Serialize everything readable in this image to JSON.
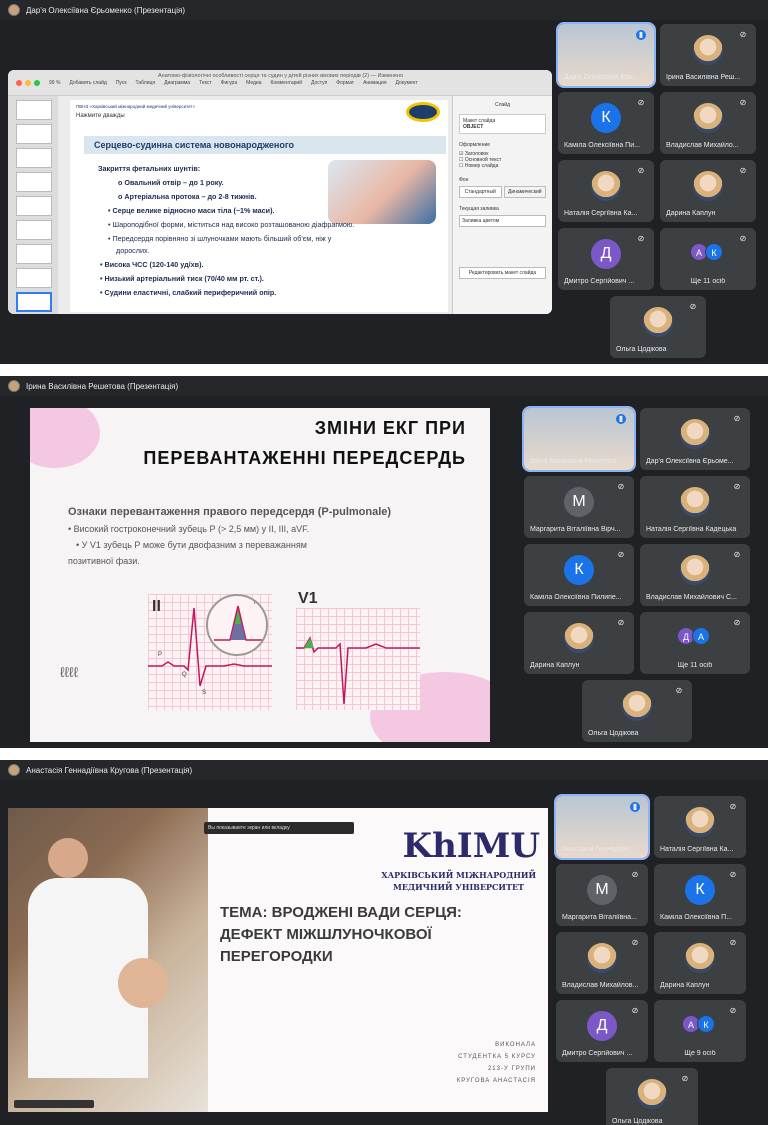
{
  "panel1": {
    "title": "Дар'я Олексіївна Єрьоменко (Презентація)",
    "keynote": {
      "window_title": "Анатомо-фізіологічні особливості серця та судин у дітей різних вікових періодів (2) — Изменено",
      "zoom": "99 %",
      "toolbar": [
        "Вид",
        "Масштаб",
        "Добавить слайд",
        "Пуск",
        "Таблиця",
        "Диаграмма",
        "Текст",
        "Фигура",
        "Медиа",
        "Комментарий",
        "Доступ",
        "Формат",
        "Анимация",
        "Документ"
      ],
      "inspector": {
        "tab": "Слайд",
        "layout_label": "Макет слайда",
        "layout_value": "OBJECT",
        "appearance": "Оформление",
        "opt1": "Заголовок",
        "opt2": "Основной текст",
        "opt3": "Номер слайда",
        "bg": "Фон",
        "bg1": "Стандартный",
        "bg2": "Динамический",
        "fill_label": "Текущая заливка",
        "fill_value": "Заливка цветом",
        "edit_btn": "Редактировать макет слайда"
      },
      "slide": {
        "org": "ПВНЗ «Харківський міжнародний медичний університет»",
        "click_hint": "Нажмите дважды",
        "heading": "Серцево-судинна система новонародженого",
        "lines": [
          "Закриття фетальних шунтів:",
          "Овальний отвір – до 1 року.",
          "Артеріальна протока – до 2-8 тижнів.",
          "Серце велике відносно маси тіла (~1% маси).",
          "Шароподібної форми, міститься над високо розташованою діафрагмою.",
          "Передсердя порівняно зі шлуночками мають більший об'єм, ніж у",
          "дорослих.",
          "Висока ЧСС (120-140 уд/хв).",
          "Низький артеріальний тиск (70/40 мм рт. ст.).",
          "Судини еластичні, слабкий периферичний опір."
        ]
      }
    },
    "participants": [
      {
        "name": "Дар'я Олексіївна Єрь...",
        "active": true
      },
      {
        "name": "Ірина Василівна Реш..."
      },
      {
        "name": "Каміла Олексіївна Пи...",
        "letter": "К",
        "color": "#1a73e8"
      },
      {
        "name": "Владислав Михайло..."
      },
      {
        "name": "Наталія Сергіївна Ка..."
      },
      {
        "name": "Дарина Каплун"
      },
      {
        "name": "Дмитро Сергійович ...",
        "letter": "Д",
        "color": "#7b57c8"
      },
      {
        "name": "Ще 11 осіб",
        "pair": [
          "А",
          "К"
        ]
      },
      {
        "name": "Ольга Цодікова"
      }
    ]
  },
  "panel2": {
    "title": "Ірина Василівна Решетова (Презентація)",
    "slide": {
      "title_line1": "ЗМІНИ ЕКГ ПРИ",
      "title_line2": "ПЕРЕВАНТАЖЕННІ ПЕРЕДСЕРДЬ",
      "subtitle": "Ознаки перевантаження правого передсердя (P-pulmonale)",
      "bullet1": "• Високий гостроконечний зубець Р (> 2,5 мм) у II, III, aVF.",
      "bullet2": "• У V1 зубець Р може бути двофазним з переважанням",
      "bullet2b": "позитивної фази.",
      "lead_ii": "II",
      "lead_v1": "V1",
      "label_p": "P",
      "label_q": "Q",
      "label_s": "S",
      "label_r": "R",
      "scribble": "ℓℓℓℓ"
    },
    "participants": [
      {
        "name": "Ірина Василівна Решетова",
        "active": true
      },
      {
        "name": "Дар'я Олексіївна Єрьоме..."
      },
      {
        "name": "Маргарита Віталіївна Вірч...",
        "letter": "М",
        "color": "#5f6368"
      },
      {
        "name": "Наталія Сергіївна Кадецька"
      },
      {
        "name": "Каміла Олексіївна Пилипе...",
        "letter": "К",
        "color": "#1a73e8"
      },
      {
        "name": "Владислав Михайлович С..."
      },
      {
        "name": "Дарина Каплун"
      },
      {
        "name": "Ще 11 осіб",
        "pair": [
          "Д",
          "А"
        ]
      },
      {
        "name": "Ольга Цодікова"
      }
    ]
  },
  "panel3": {
    "title": "Анастасія Геннадіївна Кругова (Презентація)",
    "screen_share_bar": "Вы показываете экран или вкладку",
    "slide": {
      "logo": "KhIMU",
      "uni1": "ХАРКІВСЬКИЙ МІЖНАРОДНИЙ",
      "uni2": "МЕДИЧНИЙ УНІВЕРСИТЕТ",
      "topic1": "ТЕМА: ВРОДЖЕНІ ВАДИ СЕРЦЯ:",
      "topic2": "ДЕФЕКТ МІЖШЛУНОЧКОВОЇ",
      "topic3": "ПЕРЕГОРОДКИ",
      "sig1": "ВИКОНАЛА",
      "sig2": "СТУДЕНТКА 5 КУРСУ",
      "sig3": "213-У ГРУПИ",
      "sig4": "КРУГОВА АНАСТАСІЯ"
    },
    "participants": [
      {
        "name": "Анастасія Геннадіївн...",
        "active": true
      },
      {
        "name": "Наталія Сергіївна Ка..."
      },
      {
        "name": "Маргарита Віталіївна...",
        "letter": "М",
        "color": "#5f6368"
      },
      {
        "name": "Каміла Олексіївна П...",
        "letter": "К",
        "color": "#1a73e8"
      },
      {
        "name": "Владислав Михайлов..."
      },
      {
        "name": "Дарина Каплун"
      },
      {
        "name": "Дмитро Сергійович ...",
        "letter": "Д",
        "color": "#7b57c8"
      },
      {
        "name": "Ще 9 осіб",
        "pair": [
          "А",
          "К"
        ]
      },
      {
        "name": "Ольга Цодікова"
      }
    ]
  }
}
